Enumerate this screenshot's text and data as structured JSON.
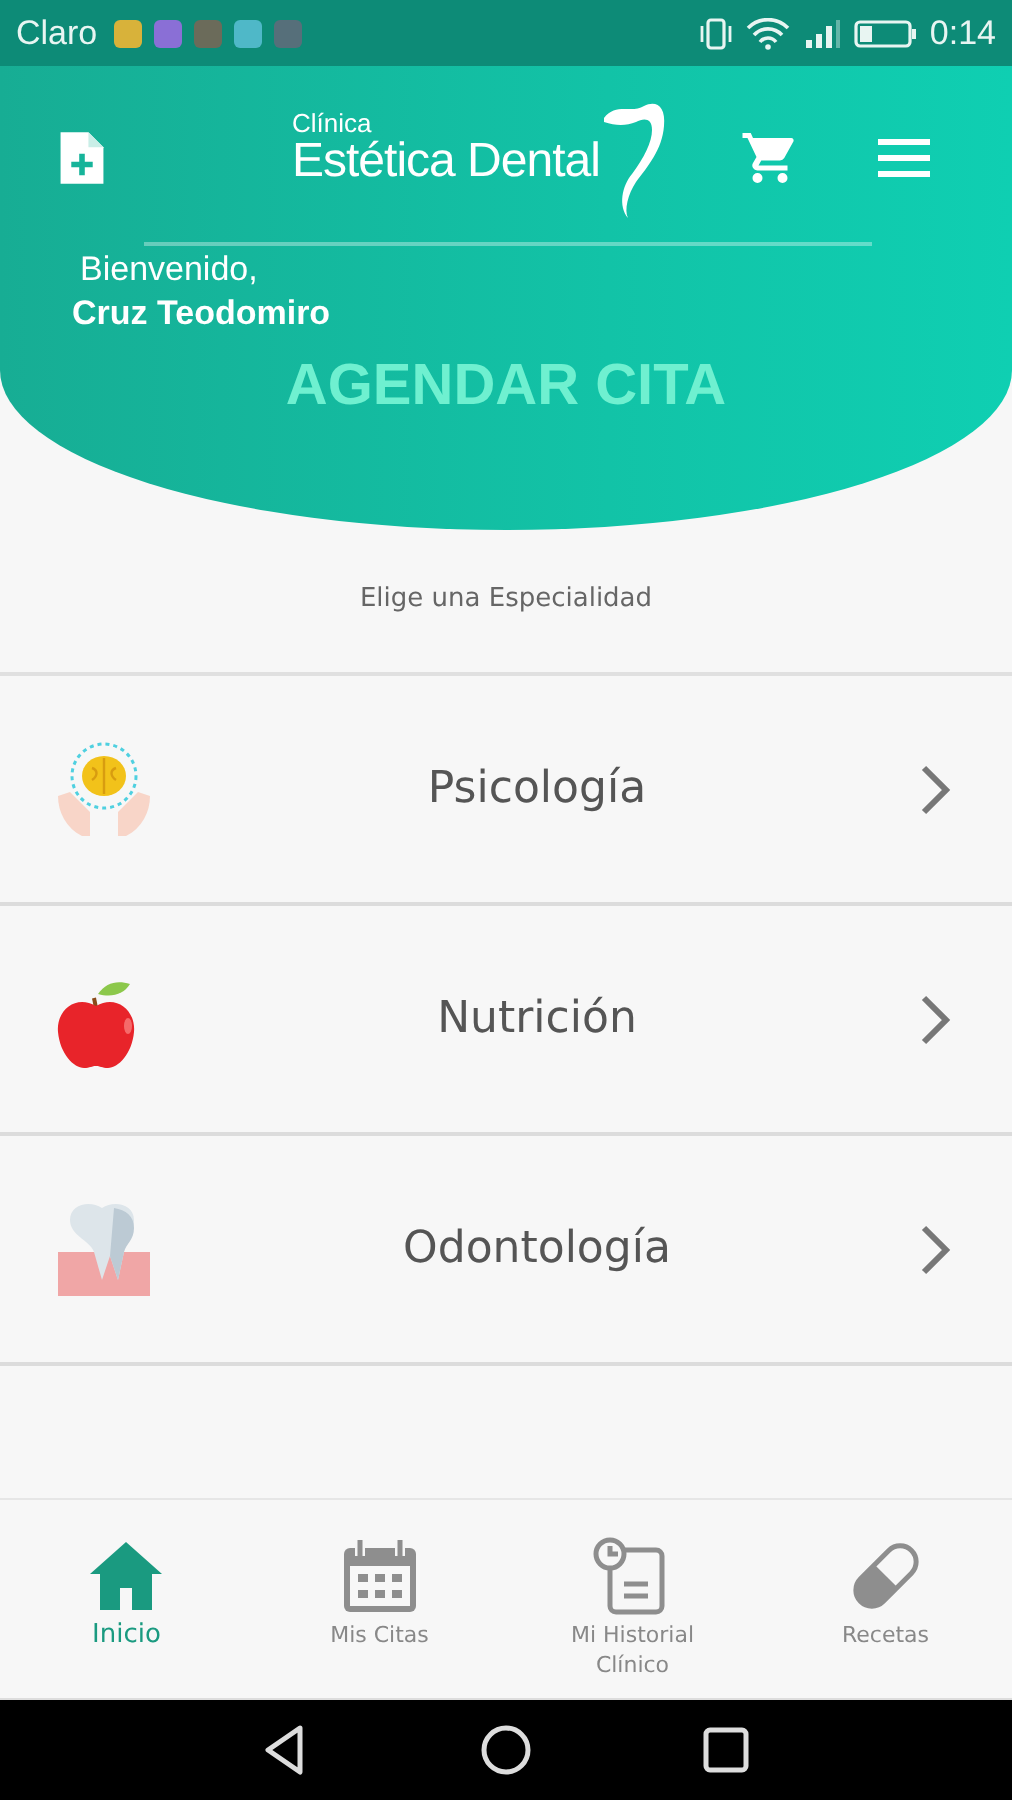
{
  "status_bar": {
    "carrier": "Claro",
    "time": "0:14"
  },
  "header": {
    "logo_small": "Clínica",
    "logo_main": "Estética Dental",
    "greeting": "Bienvenido,",
    "user_name": "Cruz Teodomiro",
    "title": "AGENDAR CITA"
  },
  "prompt": "Elige una Especialidad",
  "specialties": [
    {
      "label": "Psicología"
    },
    {
      "label": "Nutrición"
    },
    {
      "label": "Odontología"
    }
  ],
  "bottom_nav": [
    {
      "label": "Inicio",
      "selected": true
    },
    {
      "label": "Mis Citas",
      "selected": false
    },
    {
      "label": "Mi Historial Clínico",
      "selected": false
    },
    {
      "label": "Recetas",
      "selected": false
    }
  ]
}
